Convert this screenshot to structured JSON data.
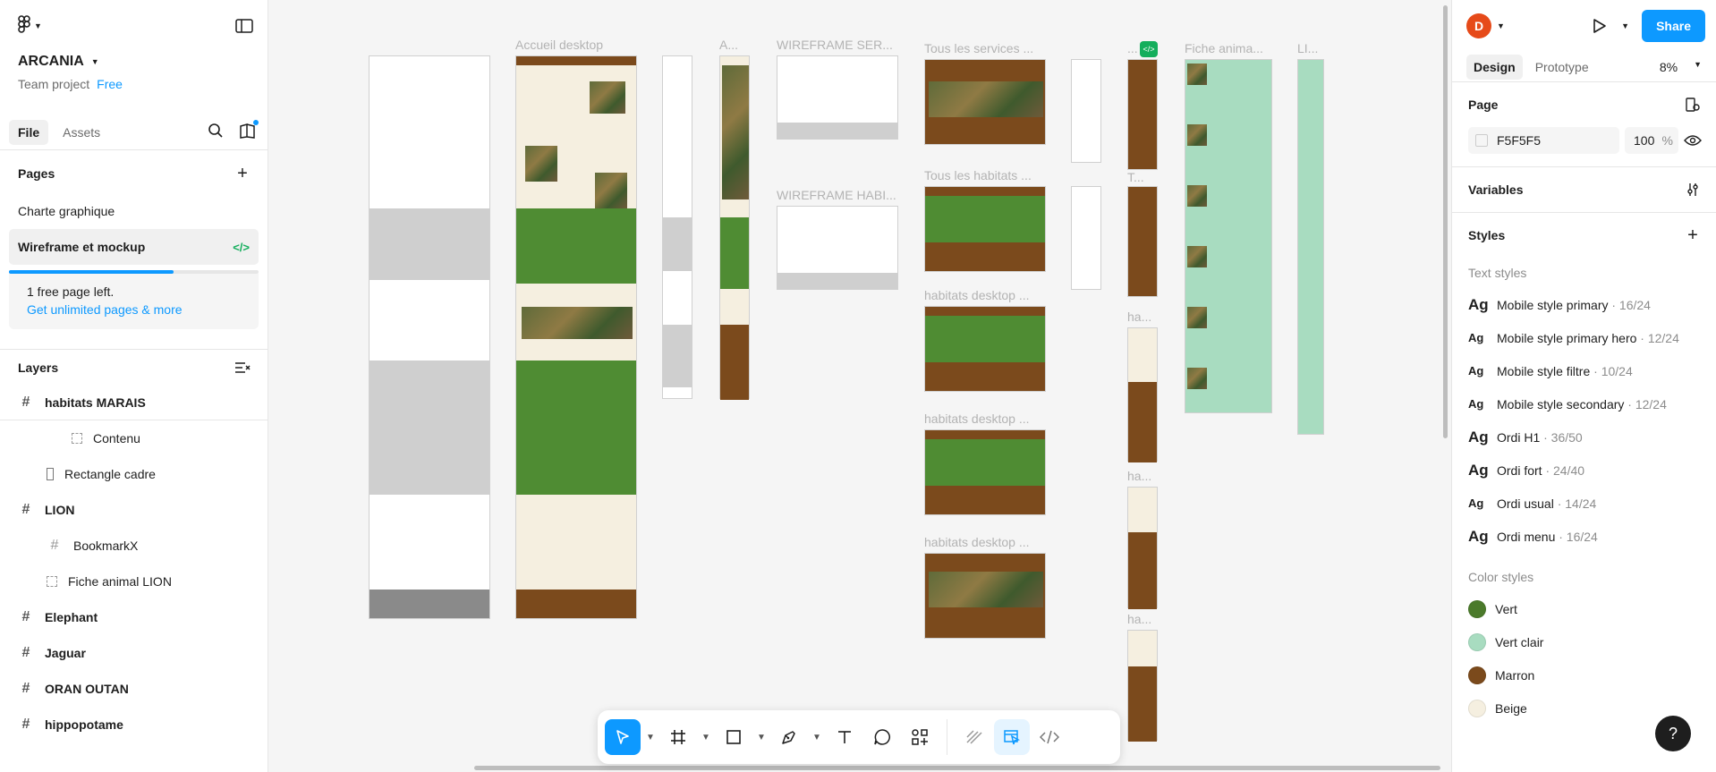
{
  "project": {
    "name": "ARCANIA",
    "team": "Team project",
    "plan": "Free"
  },
  "left_tabs": [
    "File",
    "Assets"
  ],
  "pages": {
    "title": "Pages",
    "items": [
      "Charte graphique",
      "Wireframe et mockup"
    ],
    "free_left": "1 free page left.",
    "upsell_link": "Get unlimited pages & more",
    "usage_fraction": 0.66
  },
  "layers": {
    "title": "Layers",
    "items": [
      {
        "label": "habitats MARAIS",
        "level": 0
      },
      {
        "label": "Contenu",
        "level": 2
      },
      {
        "label": "Rectangle cadre",
        "level": 1
      },
      {
        "label": "LION",
        "level": 0
      },
      {
        "label": "BookmarkX",
        "level": 1
      },
      {
        "label": "Fiche animal LION",
        "level": 1
      },
      {
        "label": "Elephant",
        "level": 0
      },
      {
        "label": "Jaguar",
        "level": 0
      },
      {
        "label": "ORAN OUTAN",
        "level": 0
      },
      {
        "label": "hippopotame",
        "level": 0
      }
    ]
  },
  "canvas": {
    "labels": {
      "accueil": "Accueil desktop",
      "a": "A...",
      "wireframe_ser": "WIREFRAME SER...",
      "tous_services": "Tous les services ...",
      "tous_habitats": "Tous les habitats ...",
      "wireframe_habi": "WIREFRAME HABI...",
      "habitats1": "habitats desktop ...",
      "habitats2": "habitats desktop ...",
      "habitats3": "habitats desktop ...",
      "fiche": "Fiche anima...",
      "li": "LI...",
      "ha1": "ha...",
      "ha2": "ha...",
      "ha3": "ha...",
      "dots": "...",
      "t": "T..."
    }
  },
  "toolbar": {
    "tools": [
      "move-tool",
      "frame-tool",
      "shape-tool",
      "pen-tool",
      "text-tool",
      "comment-tool",
      "actions-tool"
    ],
    "modes": [
      "draw-mode",
      "design-mode",
      "dev-mode"
    ]
  },
  "right": {
    "user_initial": "D",
    "share_label": "Share",
    "tabs": [
      "Design",
      "Prototype"
    ],
    "zoom": "8%",
    "page": {
      "title": "Page",
      "color": "F5F5F5",
      "opacity": "100",
      "unit": "%"
    },
    "variables_title": "Variables",
    "styles_title": "Styles",
    "text_styles_title": "Text styles",
    "text_styles": [
      {
        "name": "Mobile style primary",
        "meta": " · 16/24"
      },
      {
        "name": "Mobile style primary hero",
        "meta": " · 12/24"
      },
      {
        "name": "Mobile style filtre",
        "meta": " · 10/24"
      },
      {
        "name": "Mobile style secondary",
        "meta": " · 12/24"
      },
      {
        "name": "Ordi H1",
        "meta": " · 36/50"
      },
      {
        "name": "Ordi fort",
        "meta": " · 24/40"
      },
      {
        "name": "Ordi usual",
        "meta": " · 14/24"
      },
      {
        "name": "Ordi menu",
        "meta": " · 16/24"
      }
    ],
    "ag": "Ag",
    "color_styles_title": "Color styles",
    "color_styles": [
      {
        "name": "Vert",
        "color": "#4b7a2b"
      },
      {
        "name": "Vert clair",
        "color": "#a8dcc0"
      },
      {
        "name": "Marron",
        "color": "#7b4a1c"
      },
      {
        "name": "Beige",
        "color": "#f5efe0"
      }
    ]
  },
  "help_label": "?"
}
